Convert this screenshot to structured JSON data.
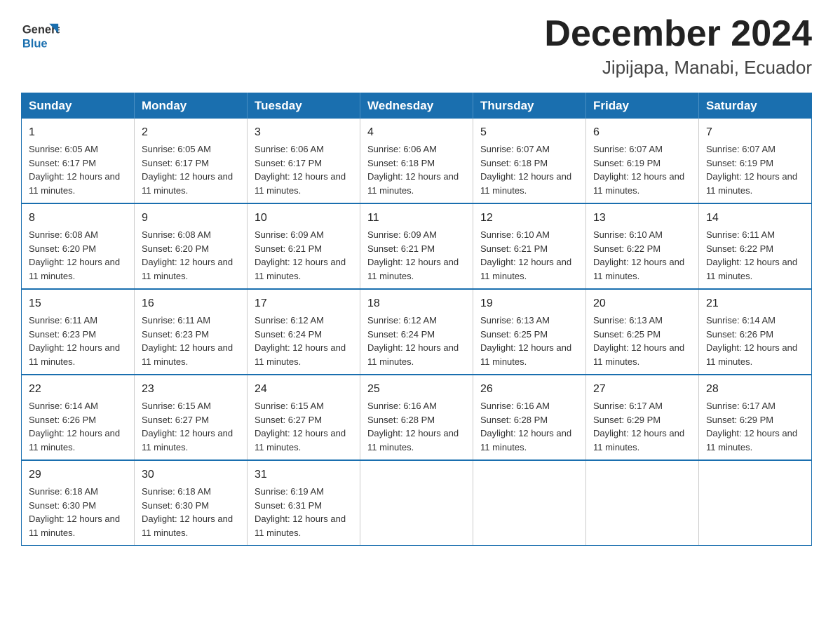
{
  "header": {
    "logo_general": "General",
    "logo_blue": "Blue",
    "month_title": "December 2024",
    "location": "Jipijapa, Manabi, Ecuador"
  },
  "days_of_week": [
    "Sunday",
    "Monday",
    "Tuesday",
    "Wednesday",
    "Thursday",
    "Friday",
    "Saturday"
  ],
  "weeks": [
    [
      {
        "day": "1",
        "sunrise": "Sunrise: 6:05 AM",
        "sunset": "Sunset: 6:17 PM",
        "daylight": "Daylight: 12 hours and 11 minutes."
      },
      {
        "day": "2",
        "sunrise": "Sunrise: 6:05 AM",
        "sunset": "Sunset: 6:17 PM",
        "daylight": "Daylight: 12 hours and 11 minutes."
      },
      {
        "day": "3",
        "sunrise": "Sunrise: 6:06 AM",
        "sunset": "Sunset: 6:17 PM",
        "daylight": "Daylight: 12 hours and 11 minutes."
      },
      {
        "day": "4",
        "sunrise": "Sunrise: 6:06 AM",
        "sunset": "Sunset: 6:18 PM",
        "daylight": "Daylight: 12 hours and 11 minutes."
      },
      {
        "day": "5",
        "sunrise": "Sunrise: 6:07 AM",
        "sunset": "Sunset: 6:18 PM",
        "daylight": "Daylight: 12 hours and 11 minutes."
      },
      {
        "day": "6",
        "sunrise": "Sunrise: 6:07 AM",
        "sunset": "Sunset: 6:19 PM",
        "daylight": "Daylight: 12 hours and 11 minutes."
      },
      {
        "day": "7",
        "sunrise": "Sunrise: 6:07 AM",
        "sunset": "Sunset: 6:19 PM",
        "daylight": "Daylight: 12 hours and 11 minutes."
      }
    ],
    [
      {
        "day": "8",
        "sunrise": "Sunrise: 6:08 AM",
        "sunset": "Sunset: 6:20 PM",
        "daylight": "Daylight: 12 hours and 11 minutes."
      },
      {
        "day": "9",
        "sunrise": "Sunrise: 6:08 AM",
        "sunset": "Sunset: 6:20 PM",
        "daylight": "Daylight: 12 hours and 11 minutes."
      },
      {
        "day": "10",
        "sunrise": "Sunrise: 6:09 AM",
        "sunset": "Sunset: 6:21 PM",
        "daylight": "Daylight: 12 hours and 11 minutes."
      },
      {
        "day": "11",
        "sunrise": "Sunrise: 6:09 AM",
        "sunset": "Sunset: 6:21 PM",
        "daylight": "Daylight: 12 hours and 11 minutes."
      },
      {
        "day": "12",
        "sunrise": "Sunrise: 6:10 AM",
        "sunset": "Sunset: 6:21 PM",
        "daylight": "Daylight: 12 hours and 11 minutes."
      },
      {
        "day": "13",
        "sunrise": "Sunrise: 6:10 AM",
        "sunset": "Sunset: 6:22 PM",
        "daylight": "Daylight: 12 hours and 11 minutes."
      },
      {
        "day": "14",
        "sunrise": "Sunrise: 6:11 AM",
        "sunset": "Sunset: 6:22 PM",
        "daylight": "Daylight: 12 hours and 11 minutes."
      }
    ],
    [
      {
        "day": "15",
        "sunrise": "Sunrise: 6:11 AM",
        "sunset": "Sunset: 6:23 PM",
        "daylight": "Daylight: 12 hours and 11 minutes."
      },
      {
        "day": "16",
        "sunrise": "Sunrise: 6:11 AM",
        "sunset": "Sunset: 6:23 PM",
        "daylight": "Daylight: 12 hours and 11 minutes."
      },
      {
        "day": "17",
        "sunrise": "Sunrise: 6:12 AM",
        "sunset": "Sunset: 6:24 PM",
        "daylight": "Daylight: 12 hours and 11 minutes."
      },
      {
        "day": "18",
        "sunrise": "Sunrise: 6:12 AM",
        "sunset": "Sunset: 6:24 PM",
        "daylight": "Daylight: 12 hours and 11 minutes."
      },
      {
        "day": "19",
        "sunrise": "Sunrise: 6:13 AM",
        "sunset": "Sunset: 6:25 PM",
        "daylight": "Daylight: 12 hours and 11 minutes."
      },
      {
        "day": "20",
        "sunrise": "Sunrise: 6:13 AM",
        "sunset": "Sunset: 6:25 PM",
        "daylight": "Daylight: 12 hours and 11 minutes."
      },
      {
        "day": "21",
        "sunrise": "Sunrise: 6:14 AM",
        "sunset": "Sunset: 6:26 PM",
        "daylight": "Daylight: 12 hours and 11 minutes."
      }
    ],
    [
      {
        "day": "22",
        "sunrise": "Sunrise: 6:14 AM",
        "sunset": "Sunset: 6:26 PM",
        "daylight": "Daylight: 12 hours and 11 minutes."
      },
      {
        "day": "23",
        "sunrise": "Sunrise: 6:15 AM",
        "sunset": "Sunset: 6:27 PM",
        "daylight": "Daylight: 12 hours and 11 minutes."
      },
      {
        "day": "24",
        "sunrise": "Sunrise: 6:15 AM",
        "sunset": "Sunset: 6:27 PM",
        "daylight": "Daylight: 12 hours and 11 minutes."
      },
      {
        "day": "25",
        "sunrise": "Sunrise: 6:16 AM",
        "sunset": "Sunset: 6:28 PM",
        "daylight": "Daylight: 12 hours and 11 minutes."
      },
      {
        "day": "26",
        "sunrise": "Sunrise: 6:16 AM",
        "sunset": "Sunset: 6:28 PM",
        "daylight": "Daylight: 12 hours and 11 minutes."
      },
      {
        "day": "27",
        "sunrise": "Sunrise: 6:17 AM",
        "sunset": "Sunset: 6:29 PM",
        "daylight": "Daylight: 12 hours and 11 minutes."
      },
      {
        "day": "28",
        "sunrise": "Sunrise: 6:17 AM",
        "sunset": "Sunset: 6:29 PM",
        "daylight": "Daylight: 12 hours and 11 minutes."
      }
    ],
    [
      {
        "day": "29",
        "sunrise": "Sunrise: 6:18 AM",
        "sunset": "Sunset: 6:30 PM",
        "daylight": "Daylight: 12 hours and 11 minutes."
      },
      {
        "day": "30",
        "sunrise": "Sunrise: 6:18 AM",
        "sunset": "Sunset: 6:30 PM",
        "daylight": "Daylight: 12 hours and 11 minutes."
      },
      {
        "day": "31",
        "sunrise": "Sunrise: 6:19 AM",
        "sunset": "Sunset: 6:31 PM",
        "daylight": "Daylight: 12 hours and 11 minutes."
      },
      null,
      null,
      null,
      null
    ]
  ]
}
